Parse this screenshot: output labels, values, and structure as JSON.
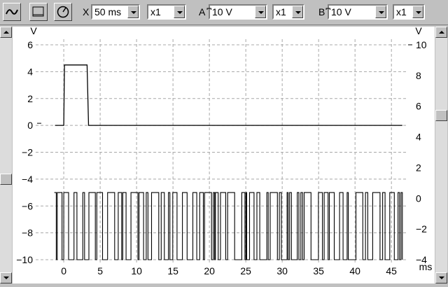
{
  "toolbar": {
    "buttons": [
      {
        "name": "waveform-icon"
      },
      {
        "name": "screen-icon"
      },
      {
        "name": "gauge-icon"
      }
    ],
    "x_label": "X",
    "x_value": "50 ms",
    "x_mult": "x1",
    "a_label": "A",
    "a_value": "⃩10 V",
    "a_mult": "x1",
    "b_label": "B",
    "b_value": "⃩10 V",
    "b_mult": "x1"
  },
  "chart_data": {
    "type": "line",
    "left_axis": {
      "unit_label": "V",
      "ticks": [
        6,
        4,
        2,
        0,
        -2,
        -4,
        -6,
        -8,
        -10
      ],
      "tick_labels": [
        "6",
        "4",
        "2",
        "0",
        "−2",
        "−4",
        "−6",
        "−8",
        "−10"
      ],
      "range": [
        -10,
        6
      ]
    },
    "right_axis": {
      "unit_label": "V",
      "ticks": [
        10,
        8,
        6,
        4,
        2,
        0,
        -2,
        -4
      ],
      "tick_labels": [
        "10",
        "8",
        "6",
        "4",
        "2",
        "0",
        "−2",
        "−4"
      ],
      "range": [
        -4,
        10
      ]
    },
    "x_axis": {
      "unit_label": "ms",
      "ticks": [
        0,
        5,
        10,
        15,
        20,
        25,
        30,
        35,
        40,
        45
      ],
      "tick_labels": [
        "0",
        "5",
        "10",
        "15",
        "20",
        "25",
        "30",
        "35",
        "40",
        "45"
      ],
      "range": [
        -2.7,
        47
      ]
    },
    "grid": true,
    "series": [
      {
        "axis": "left",
        "points": [
          [
            -1.2,
            0
          ],
          [
            0,
            0
          ],
          [
            0.1,
            4.5
          ],
          [
            3.2,
            4.5
          ],
          [
            3.4,
            0
          ],
          [
            46.5,
            0
          ]
        ]
      },
      {
        "axis": "left",
        "range": [
          -10,
          -5
        ],
        "pattern": "random digital square wave"
      }
    ]
  }
}
